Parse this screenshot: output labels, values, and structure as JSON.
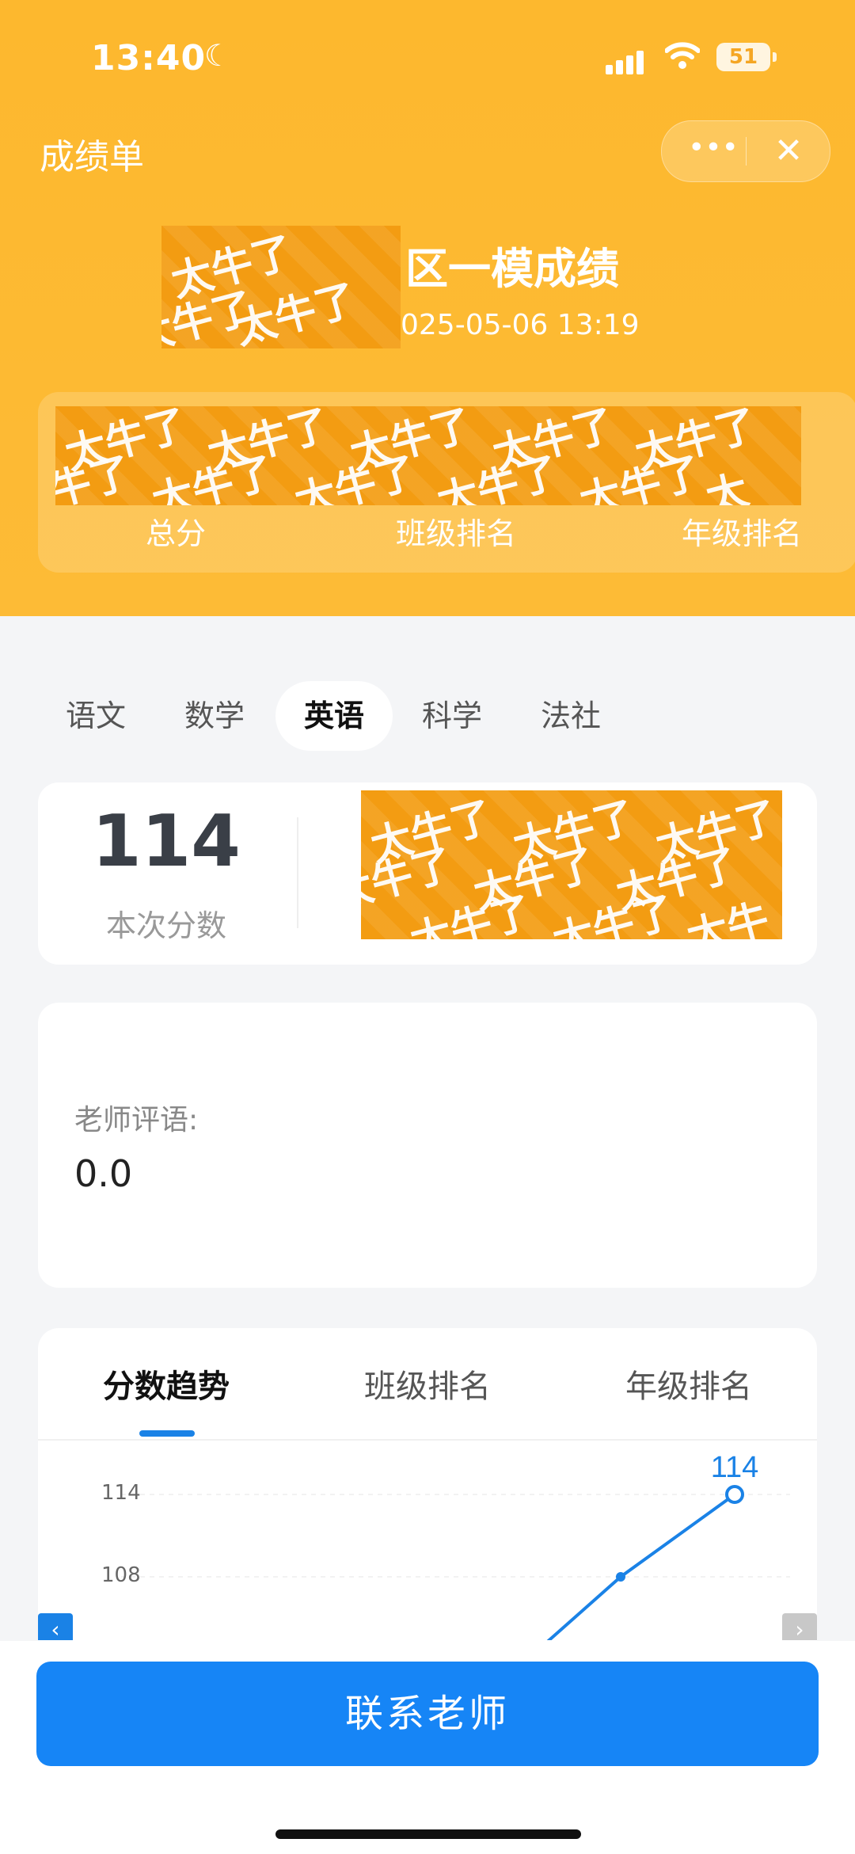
{
  "status_bar": {
    "time": "13:40",
    "battery": "51"
  },
  "nav": {
    "title": "成绩单",
    "more_label": "•••",
    "close_label": "✕"
  },
  "exam": {
    "title": "区一模成绩",
    "date": "025-05-06 13:19"
  },
  "summary": {
    "labels": [
      "总分",
      "班级排名",
      "年级排名"
    ]
  },
  "subjects": [
    "语文",
    "数学",
    "英语",
    "科学",
    "法社"
  ],
  "active_subject": "英语",
  "score": {
    "value": "114",
    "label": "本次分数"
  },
  "comment": {
    "label": "老师评语:",
    "value": "0.0"
  },
  "chart_tabs": [
    "分数趋势",
    "班级排名",
    "年级排名"
  ],
  "chart_data": {
    "type": "line",
    "title": "",
    "xlabel": "",
    "ylabel": "",
    "y_ticks": [
      "114",
      "108"
    ],
    "series": [
      {
        "values": [
          {
            "y": 108
          },
          {
            "y": 114
          }
        ]
      }
    ],
    "data_labels": [
      "114"
    ],
    "color": "#1a82e6"
  },
  "cta": {
    "label": "联系老师"
  },
  "colors": {
    "header": "#fdb82e",
    "accent": "#1685f6",
    "mosaic": "#f39c12"
  },
  "mosaic_text": "太牛了"
}
